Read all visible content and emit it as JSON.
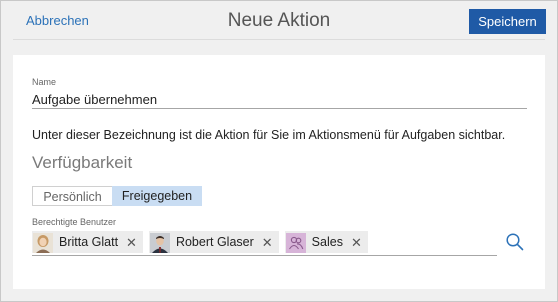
{
  "header": {
    "cancel_label": "Abbrechen",
    "title": "Neue Aktion",
    "save_label": "Speichern"
  },
  "form": {
    "name_label": "Name",
    "name_value": "Aufgabe übernehmen",
    "hint": "Unter dieser Bezeichnung ist die Aktion für Sie im Aktionsmenü für Aufgaben sichtbar.",
    "availability_heading": "Verfügbarkeit",
    "availability_options": [
      {
        "label": "Persönlich",
        "selected": false
      },
      {
        "label": "Freigegeben",
        "selected": true
      }
    ],
    "users_label": "Berechtigte Benutzer",
    "users": [
      {
        "name": "Britta Glatt",
        "icon": "person-photo",
        "remove": "✕"
      },
      {
        "name": "Robert Glaser",
        "icon": "person-photo",
        "remove": "✕"
      },
      {
        "name": "Sales",
        "icon": "group-icon",
        "remove": "✕"
      }
    ],
    "search_icon": "search-icon"
  },
  "colors": {
    "accent": "#1f5aa6",
    "link": "#2c72b8",
    "selected_toggle": "#c9ddf3",
    "group_avatar": "#d7b4d8"
  }
}
